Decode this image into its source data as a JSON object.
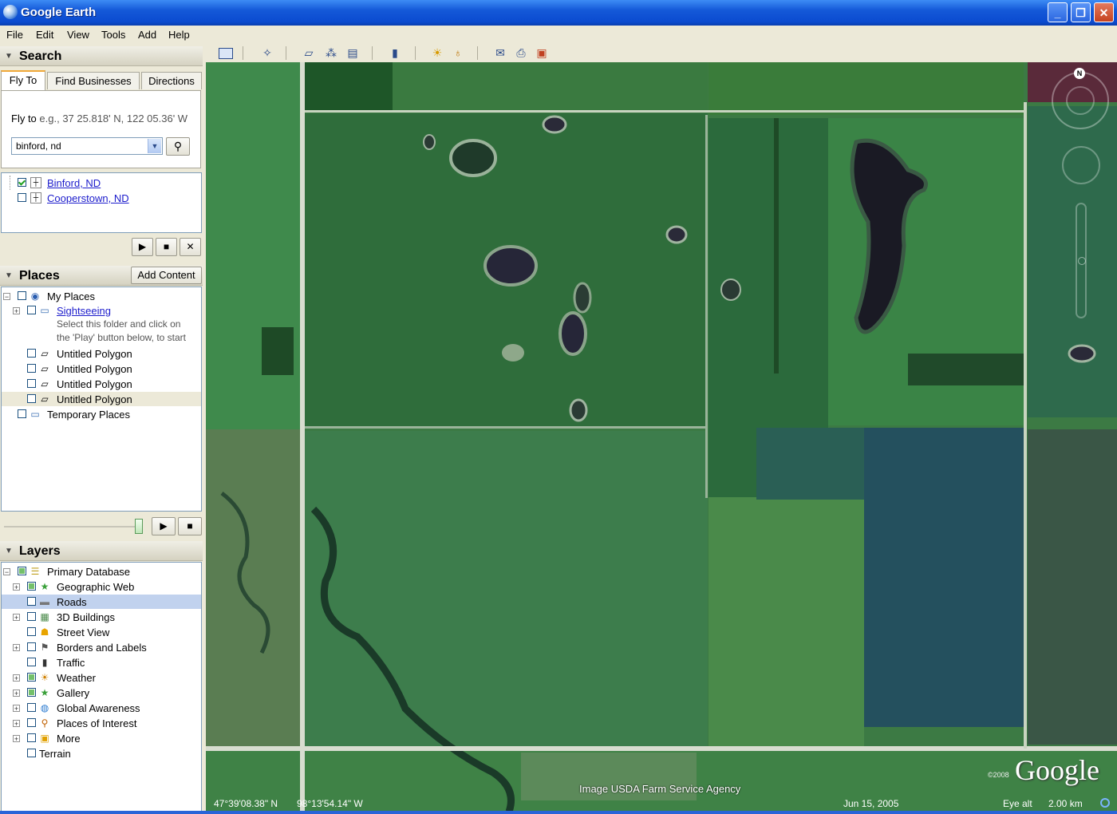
{
  "window": {
    "title": "Google Earth",
    "controls": {
      "minimize": "_",
      "maximize": "❐",
      "close": "✕"
    }
  },
  "menu": [
    "File",
    "Edit",
    "View",
    "Tools",
    "Add",
    "Help"
  ],
  "search": {
    "header": "Search",
    "tabs": [
      "Fly To",
      "Find Businesses",
      "Directions"
    ],
    "fly_to_label": "Fly to",
    "fly_to_hint": "e.g., 37 25.818' N, 122 05.36' W",
    "input_value": "binford, nd",
    "results": [
      {
        "label": "Binford, ND",
        "checked": true
      },
      {
        "label": "Cooperstown, ND",
        "checked": false
      }
    ]
  },
  "places": {
    "header": "Places",
    "add_content": "Add Content",
    "my_places": "My Places",
    "sightseeing": "Sightseeing",
    "sightseeing_note_1": "Select this folder and click on",
    "sightseeing_note_2": "the 'Play' button below, to start",
    "polygons": [
      "Untitled Polygon",
      "Untitled Polygon",
      "Untitled Polygon",
      "Untitled Polygon"
    ],
    "temporary": "Temporary Places"
  },
  "layers": {
    "header": "Layers",
    "primary": "Primary Database",
    "items": [
      {
        "label": "Geographic Web",
        "icon": "star-icon",
        "state": "partial",
        "expandable": true
      },
      {
        "label": "Roads",
        "icon": "road-icon",
        "state": "unchecked",
        "expandable": false,
        "selected": true
      },
      {
        "label": "3D Buildings",
        "icon": "building-icon",
        "state": "unchecked",
        "expandable": true
      },
      {
        "label": "Street View",
        "icon": "pegman-icon",
        "state": "unchecked",
        "expandable": false
      },
      {
        "label": "Borders and Labels",
        "icon": "flag-icon",
        "state": "unchecked",
        "expandable": true
      },
      {
        "label": "Traffic",
        "icon": "traffic-light-icon",
        "state": "unchecked",
        "expandable": false
      },
      {
        "label": "Weather",
        "icon": "sun-icon",
        "state": "partial",
        "expandable": true
      },
      {
        "label": "Gallery",
        "icon": "star-icon",
        "state": "partial",
        "expandable": true
      },
      {
        "label": "Global Awareness",
        "icon": "globe-icon",
        "state": "unchecked",
        "expandable": true
      },
      {
        "label": "Places of Interest",
        "icon": "pin-icon",
        "state": "unchecked",
        "expandable": true
      },
      {
        "label": "More",
        "icon": "more-icon",
        "state": "unchecked",
        "expandable": true
      }
    ],
    "terrain": "Terrain"
  },
  "map": {
    "attribution": "Image USDA Farm Service Agency",
    "copyright_year": "©2008",
    "logo": "Google",
    "compass_north": "N"
  },
  "status": {
    "latitude": "47°39'08.38\" N",
    "longitude": "98°13'54.14\" W",
    "date": "Jun 15, 2005",
    "eye_alt_label": "Eye alt",
    "eye_alt_value": "2.00 km"
  },
  "colors": {
    "titlebar": "#0b4bd0",
    "link": "#1c1ccc",
    "selected_row": "#c1d2ee",
    "field_green": "#3f7a45"
  }
}
